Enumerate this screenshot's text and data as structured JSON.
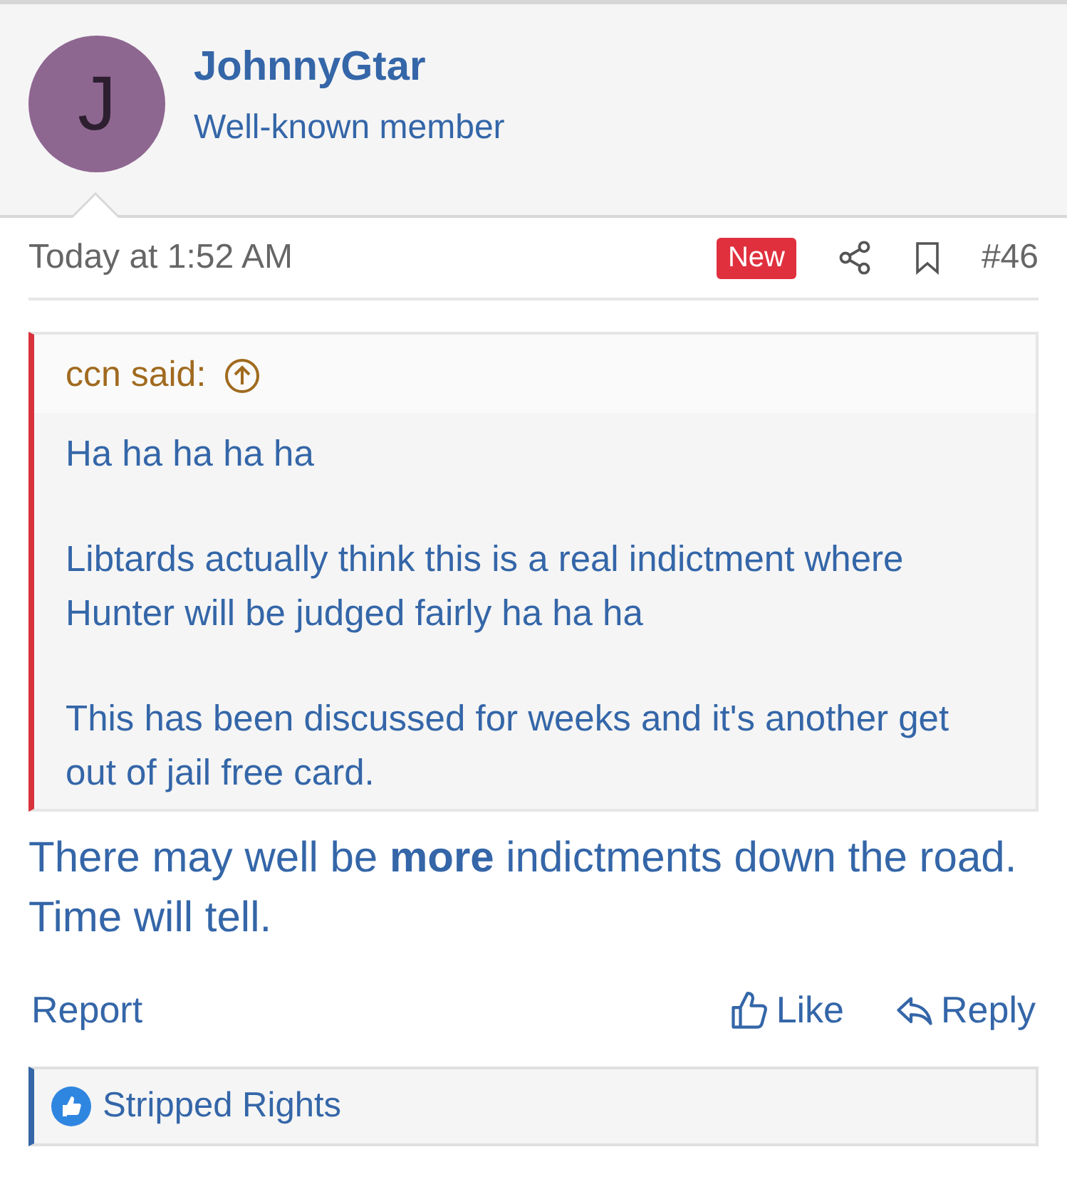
{
  "author": {
    "avatar_letter": "J",
    "name": "JohnnyGtar",
    "title": "Well-known member"
  },
  "meta": {
    "time": "Today at 1:52 AM",
    "badge": "New",
    "post_number": "#46"
  },
  "quote": {
    "attribution": "ccn said:",
    "paragraphs": [
      "Ha ha ha ha ha",
      "Libtards actually think this is a real indictment where Hunter will be judged fairly ha ha ha",
      "This has been discussed for weeks and it's another get out of jail free card."
    ]
  },
  "body": "There may well be **more** indictments down the road. Time will tell.",
  "actions": {
    "report": "Report",
    "like": "Like",
    "reply": "Reply"
  },
  "reactions": {
    "users": "Stripped Rights"
  }
}
